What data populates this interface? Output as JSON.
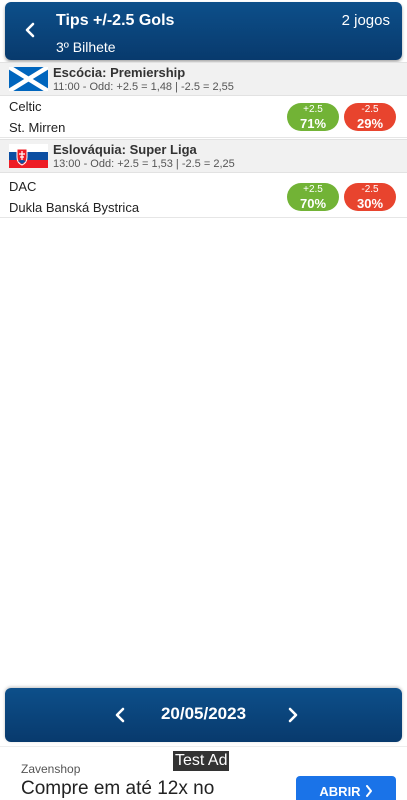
{
  "header": {
    "title": "Tips +/-2.5 Gols",
    "subtitle": "3º Bilhete",
    "count": "2 jogos"
  },
  "leagues": [
    {
      "flag_icon": "scotland-flag-icon",
      "name": "Escócia: Premiership",
      "odds": "11:00 - Odd: +2.5 = 1,48 | -2.5 = 2,55",
      "match": {
        "home": "Celtic",
        "away": "St. Mirren",
        "over_label": "+2.5",
        "over_pct": "71%",
        "under_label": "-2.5",
        "under_pct": "29%"
      }
    },
    {
      "flag_icon": "slovakia-flag-icon",
      "name": "Eslováquia: Super Liga",
      "odds": "13:00 - Odd: +2.5 = 1,53 | -2.5 = 2,25",
      "match": {
        "home": "DAC",
        "away": "Dukla Banská Bystrica",
        "over_label": "+2.5",
        "over_pct": "70%",
        "under_label": "-2.5",
        "under_pct": "30%"
      }
    }
  ],
  "date_nav": {
    "date": "20/05/2023"
  },
  "ad": {
    "badge": "Test Ad",
    "brand": "Zavenshop",
    "headline": "Compre em até 12x no",
    "cta": "ABRIR"
  },
  "colors": {
    "header_blue": "#0b4a83",
    "over_green": "#72b336",
    "under_red": "#e8442e",
    "cta_blue": "#1a73e8"
  }
}
